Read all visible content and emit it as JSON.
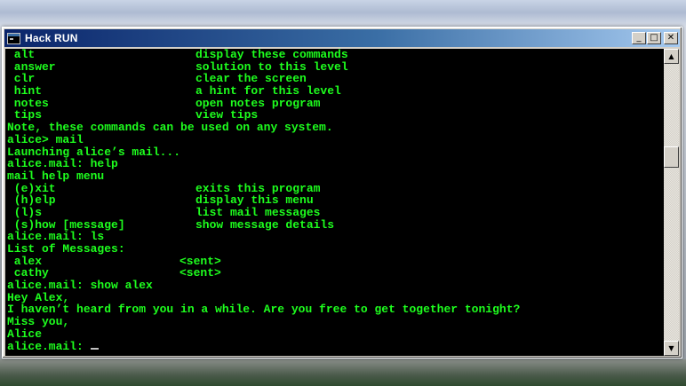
{
  "window": {
    "title": "Hack RUN",
    "minimize_glyph": "_",
    "maximize_glyph": "□",
    "close_glyph": "✕",
    "icon": "console-app-icon"
  },
  "terminal": {
    "text_color": "#1eff1e",
    "background": "#000000",
    "lines": [
      {
        "left": " alt",
        "right": "display these commands"
      },
      {
        "left": " answer",
        "right": "solution to this level"
      },
      {
        "left": " clr",
        "right": "clear the screen"
      },
      {
        "left": " hint",
        "right": "a hint for this level"
      },
      {
        "left": " notes",
        "right": "open notes program"
      },
      {
        "left": " tips",
        "right": "view tips"
      },
      {
        "left": "Note, these commands can be used on any system.",
        "right": ""
      },
      {
        "left": "alice> mail",
        "right": ""
      },
      {
        "left": "Launching alice’s mail...",
        "right": ""
      },
      {
        "left": "alice.mail: help",
        "right": ""
      },
      {
        "left": "mail help menu",
        "right": ""
      },
      {
        "left": " (e)xit",
        "right": "exits this program"
      },
      {
        "left": " (h)elp",
        "right": "display this menu"
      },
      {
        "left": " (l)s",
        "right": "list mail messages"
      },
      {
        "left": " (s)how [message]",
        "right": "show message details"
      },
      {
        "left": "alice.mail: ls",
        "right": ""
      },
      {
        "left": "List of Messages:",
        "right": ""
      },
      {
        "left": " alex",
        "right": "<sent>",
        "narrow": true
      },
      {
        "left": " cathy",
        "right": "<sent>",
        "narrow": true
      },
      {
        "left": "alice.mail: show alex",
        "right": ""
      },
      {
        "left": "Hey Alex,",
        "right": ""
      },
      {
        "left": "I haven’t heard from you in a while. Are you free to get together tonight?",
        "right": ""
      },
      {
        "left": "Miss you,",
        "right": ""
      },
      {
        "left": "Alice",
        "right": ""
      }
    ],
    "prompt": "alice.mail: "
  },
  "scrollbar": {
    "up_glyph": "▲",
    "down_glyph": "▼"
  }
}
